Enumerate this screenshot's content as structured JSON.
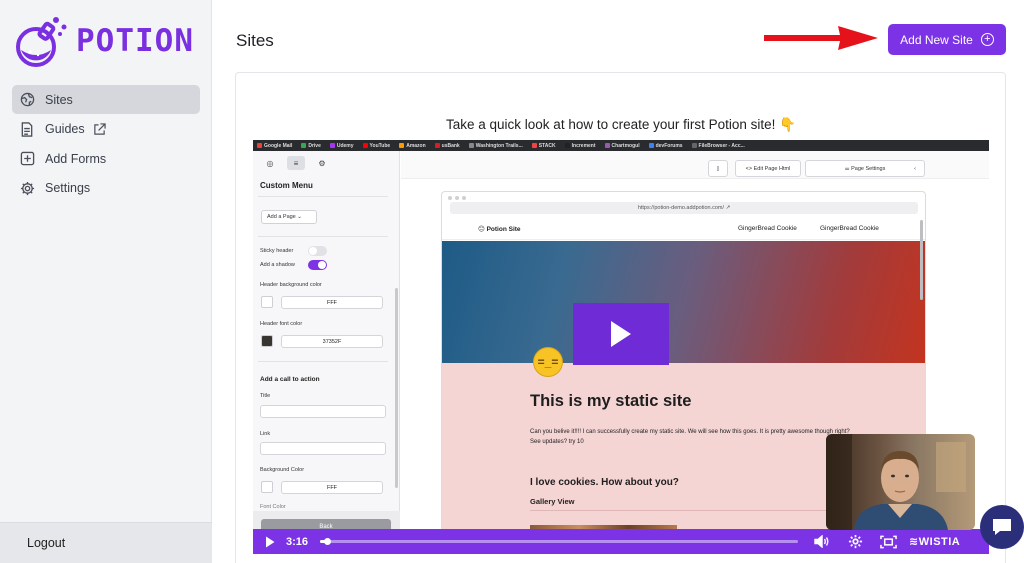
{
  "app": {
    "name": "POTION"
  },
  "sidebar": {
    "items": [
      {
        "label": "Sites",
        "icon": "globe-icon",
        "active": true
      },
      {
        "label": "Guides",
        "icon": "document-icon",
        "external": true
      },
      {
        "label": "Add Forms",
        "icon": "add-square-icon"
      },
      {
        "label": "Settings",
        "icon": "gear-icon"
      }
    ],
    "logout_label": "Logout"
  },
  "header": {
    "title": "Sites",
    "add_button_label": "Add New Site",
    "add_button_icon": "plus-circle-icon"
  },
  "colors": {
    "brand": "#7c33e6",
    "arrow": "#e5121c",
    "chat": "#2b2f7a"
  },
  "video": {
    "caption": "Take a quick look at how to create your first Potion site! 👇",
    "time": "3:16",
    "progress_fraction": 0.015,
    "brand": "WISTIA",
    "bookmarks": [
      "Google Mail",
      "Drive",
      "Udemy",
      "YouTube",
      "Amazon",
      "usBank",
      "Washington Trails...",
      "STACK",
      "Increment",
      "Chartmogul",
      "devForums",
      "FileBrowser - Acc..."
    ],
    "editor": {
      "panel_title": "Custom Menu",
      "add_page": "Add a Page",
      "sticky_header": "Sticky header",
      "add_shadow": "Add a shadow",
      "header_bg_label": "Header background color",
      "header_bg_value": "FFF",
      "header_font_label": "Header font color",
      "header_font_value": "37352F",
      "cta_title": "Add a call to action",
      "title_label": "Title",
      "link_label": "Link",
      "bg_color_label": "Background Color",
      "bg_color_value": "FFF",
      "font_color_label": "Font Color",
      "back_label": "Back",
      "edit_html": "Edit Page Html",
      "page_settings": "Page Settings"
    },
    "site": {
      "url": "https://potion-demo.addpotion.com/",
      "brand": "😑 Potion Site",
      "nav_links": [
        "GingerBread Cookie",
        "GingerBread Cookie"
      ],
      "heading": "This is my static site",
      "paragraph": "Can you belive  it!!!! I can successfully create my static site. We will see how this goes. It is pretty awesome though right? See updates? try 10",
      "subheading": "I love cookies. How about you?",
      "gallery": "Gallery View"
    }
  }
}
